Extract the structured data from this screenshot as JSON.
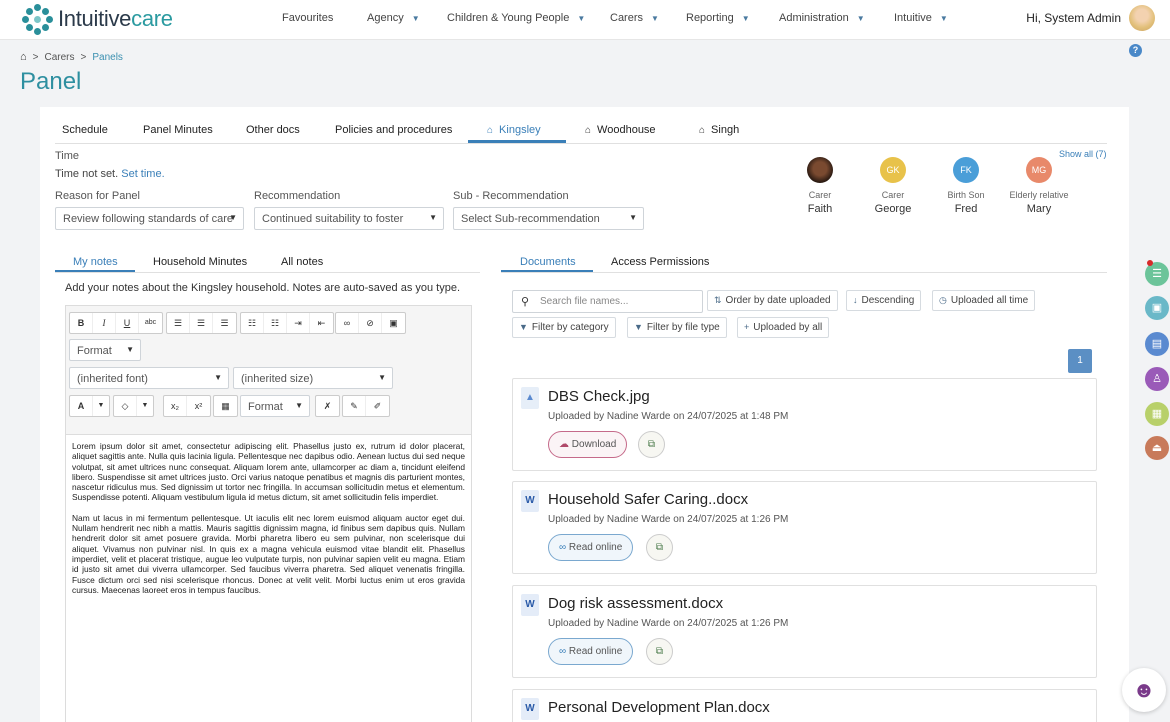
{
  "app": {
    "brand_part1": "Intuitive",
    "brand_part2": "care"
  },
  "nav": [
    {
      "label": "Favourites",
      "dropdown": false
    },
    {
      "label": "Agency",
      "dropdown": true
    },
    {
      "label": "Children & Young People",
      "dropdown": true
    },
    {
      "label": "Carers",
      "dropdown": true
    },
    {
      "label": "Reporting",
      "dropdown": true
    },
    {
      "label": "Administration",
      "dropdown": true
    },
    {
      "label": "Intuitive",
      "dropdown": true
    }
  ],
  "user": {
    "greeting": "Hi, System Admin"
  },
  "breadcrumb": {
    "items": [
      "Carers",
      "Panels"
    ],
    "separator": ">"
  },
  "page": {
    "title": "Panel",
    "help": "?"
  },
  "tabs": [
    {
      "label": "Schedule",
      "icon": "",
      "active": false
    },
    {
      "label": "Panel Minutes",
      "icon": "",
      "active": false
    },
    {
      "label": "Other docs",
      "icon": "",
      "active": false
    },
    {
      "label": "Policies and procedures",
      "icon": "",
      "active": false
    },
    {
      "label": "Kingsley",
      "icon": "house-icon",
      "active": true
    },
    {
      "label": "Woodhouse",
      "icon": "house-icon",
      "active": false
    },
    {
      "label": "Singh",
      "icon": "house-icon",
      "active": false
    }
  ],
  "time": {
    "label": "Time",
    "value": "Time not set.",
    "set_link": "Set time."
  },
  "reason": {
    "label": "Reason for Panel",
    "value": "Review following standards of care"
  },
  "recommendation": {
    "label": "Recommendation",
    "value": "Continued suitability to foster"
  },
  "sub_recommendation": {
    "label": "Sub - Recommendation",
    "placeholder": "Select Sub-recommendation"
  },
  "household": {
    "show_all": "Show all (7)",
    "members": [
      {
        "role": "Carer",
        "name": "Faith",
        "initials": "",
        "color": "#5a3a2a"
      },
      {
        "role": "Carer",
        "name": "George",
        "initials": "GK",
        "color": "#e8c24a"
      },
      {
        "role": "Birth Son",
        "name": "Fred",
        "initials": "FK",
        "color": "#4a9ed8"
      },
      {
        "role": "Elderly relative",
        "name": "Mary",
        "initials": "MG",
        "color": "#e8896a"
      }
    ]
  },
  "notes": {
    "tabs": [
      "My notes",
      "Household Minutes",
      "All notes"
    ],
    "active_tab": "My notes",
    "hint": "Add your notes about the Kingsley household. Notes are auto-saved as you type.",
    "format_label": "Format",
    "font_placeholder": "(inherited font)",
    "size_placeholder": "(inherited size)",
    "format2_label": "Format",
    "paragraphs": [
      "Lorem ipsum dolor sit amet, consectetur adipiscing elit. Phasellus justo ex, rutrum id dolor placerat, aliquet sagittis ante. Nulla quis lacinia ligula. Pellentesque nec dapibus odio. Aenean luctus dui sed neque volutpat, sit amet ultrices nunc consequat. Aliquam lorem ante, ullamcorper ac diam a, tincidunt eleifend libero. Suspendisse sit amet ultrices justo. Orci varius natoque penatibus et magnis dis parturient montes, nascetur ridiculus mus. Sed dignissim ut tortor nec fringilla. In accumsan sollicitudin metus et elementum. Suspendisse potenti. Aliquam vestibulum ligula id metus dictum, sit amet sollicitudin felis imperdiet.",
      "Nam ut lacus in mi fermentum pellentesque. Ut iaculis elit nec lorem euismod aliquam auctor eget dui. Nullam hendrerit nec nibh a mattis. Mauris sagittis dignissim magna, id finibus sem dapibus quis. Nullam hendrerit dolor sit amet posuere gravida. Morbi pharetra libero eu sem pulvinar, non scelerisque dui aliquet. Vivamus non pulvinar nisl. In quis ex a magna vehicula euismod vitae blandit elit. Phasellus imperdiet, velit et placerat tristique, augue leo vulputate turpis, non pulvinar sapien velit eu magna. Etiam id justo sit amet dui viverra ullamcorper. Sed faucibus viverra pharetra. Sed aliquet venenatis fringilla. Fusce dictum orci sed nisi scelerisque rhoncus. Donec at velit velit. Morbi luctus enim ut eros gravida cursus. Maecenas laoreet eros in tempus faucibus."
    ]
  },
  "documents": {
    "tabs": [
      "Documents",
      "Access Permissions"
    ],
    "active_tab": "Documents",
    "search_placeholder": "Search file names...",
    "filters": [
      "Order by date uploaded",
      "Descending",
      "Uploaded all time",
      "Filter by category",
      "Filter by file type",
      "Uploaded by all"
    ],
    "page": "1",
    "items": [
      {
        "name": "DBS Check.jpg",
        "meta": "Uploaded by Nadine Warde on 24/07/2025 at 1:48 PM",
        "action": "Download",
        "type": "image"
      },
      {
        "name": "Household Safer Caring..docx",
        "meta": "Uploaded by Nadine Warde on 24/07/2025 at 1:26 PM",
        "action": "Read online",
        "type": "word"
      },
      {
        "name": "Dog risk assessment.docx",
        "meta": "Uploaded by Nadine Warde on 24/07/2025 at 1:26 PM",
        "action": "Read online",
        "type": "word"
      },
      {
        "name": "Personal Development Plan.docx",
        "meta": "",
        "action": "",
        "type": "word"
      }
    ]
  },
  "side_buttons": [
    {
      "icon": "list-icon",
      "color": "#6cc49a"
    },
    {
      "icon": "briefcase-icon",
      "color": "#6ab8c8"
    },
    {
      "icon": "document-icon",
      "color": "#5a8ad0"
    },
    {
      "icon": "person-icon",
      "color": "#9a5ab8"
    },
    {
      "icon": "calendar-icon",
      "color": "#b8d06a"
    },
    {
      "icon": "stamp-icon",
      "color": "#c87a5a"
    }
  ]
}
